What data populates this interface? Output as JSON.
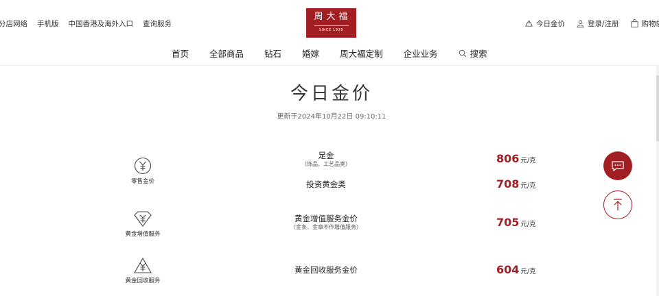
{
  "topbar": {
    "left_links": [
      "分店网络",
      "手机版",
      "中国香港及海外入口",
      "查询服务"
    ],
    "brand": {
      "name_cn": "周大福",
      "since": "SINCE 1929"
    },
    "right_links": [
      {
        "label": "今日金价",
        "icon": "gold-ingot-icon"
      },
      {
        "label": "登录/注册",
        "icon": "user-icon"
      },
      {
        "label": "购物袋",
        "icon": "shopping-bag-icon"
      }
    ]
  },
  "nav": {
    "items": [
      "首页",
      "全部商品",
      "钻石",
      "婚嫁",
      "周大福定制",
      "企业业务"
    ],
    "search_label": "搜索"
  },
  "page": {
    "title": "今日金价",
    "updated": "更新于2024年10月22日 09:10:11"
  },
  "categories": [
    {
      "label": "零售金价",
      "icon": "yuan-circle-icon"
    },
    {
      "label": "黄金增值服务",
      "icon": "yuan-diamond-icon"
    },
    {
      "label": "黄金回收服务",
      "icon": "recycle-yuan-icon"
    }
  ],
  "prices": [
    {
      "name": "足金",
      "sub": "（饰品、工艺品类）",
      "value": "806",
      "unit": "元/克"
    },
    {
      "name": "投资黄金类",
      "sub": "",
      "value": "708",
      "unit": "元/克"
    },
    {
      "name": "黄金增值服务金价",
      "sub": "（金条、金章不作增值服务）",
      "value": "705",
      "unit": "元/克"
    },
    {
      "name": "黄金回收服务金价",
      "sub": "",
      "value": "604",
      "unit": "元/克"
    }
  ],
  "colors": {
    "brand": "#a11e23",
    "text": "#333333",
    "muted": "#666666"
  },
  "floating": {
    "chat_icon": "chat-icon",
    "top_icon": "back-to-top-icon"
  }
}
